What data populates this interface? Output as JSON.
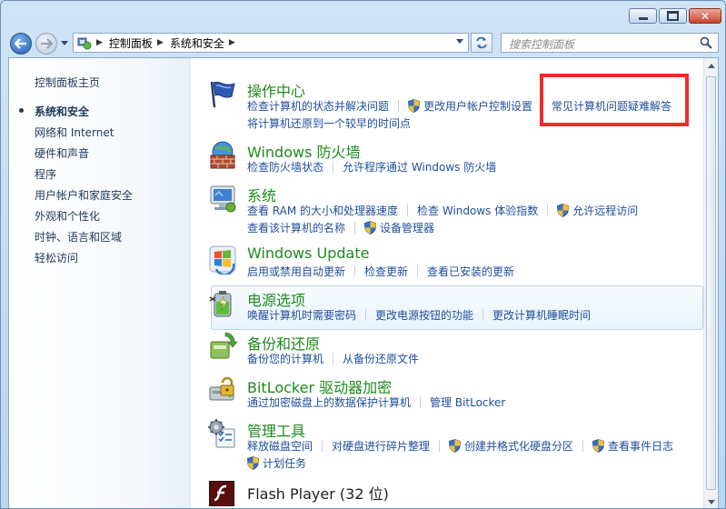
{
  "nav": {
    "breadcrumb": [
      "控制面板",
      "系统和安全"
    ],
    "search_placeholder": "搜索控制面板"
  },
  "sidebar": {
    "home": "控制面板主页",
    "items": [
      {
        "label": "系统和安全",
        "active": true
      },
      {
        "label": "网络和 Internet"
      },
      {
        "label": "硬件和声音"
      },
      {
        "label": "程序"
      },
      {
        "label": "用户帐户和家庭安全"
      },
      {
        "label": "外观和个性化"
      },
      {
        "label": "时钟、语言和区域"
      },
      {
        "label": "轻松访问"
      }
    ]
  },
  "categories": {
    "action_center": {
      "title": "操作中心",
      "links": [
        "检查计算机的状态并解决问题",
        "更改用户帐户控制设置",
        "常见计算机问题疑难解答",
        "将计算机还原到一个较早的时间点"
      ]
    },
    "firewall": {
      "title": "Windows 防火墙",
      "links": [
        "检查防火墙状态",
        "允许程序通过 Windows 防火墙"
      ]
    },
    "system": {
      "title": "系统",
      "links": [
        "查看 RAM 的大小和处理器速度",
        "检查 Windows 体验指数",
        "允许远程访问",
        "查看该计算机的名称",
        "设备管理器"
      ]
    },
    "windows_update": {
      "title": "Windows Update",
      "links": [
        "启用或禁用自动更新",
        "检查更新",
        "查看已安装的更新"
      ]
    },
    "power": {
      "title": "电源选项",
      "links": [
        "唤醒计算机时需要密码",
        "更改电源按钮的功能",
        "更改计算机睡眠时间"
      ]
    },
    "backup": {
      "title": "备份和还原",
      "links": [
        "备份您的计算机",
        "从备份还原文件"
      ]
    },
    "bitlocker": {
      "title": "BitLocker 驱动器加密",
      "links": [
        "通过加密磁盘上的数据保护计算机",
        "管理 BitLocker"
      ]
    },
    "admin_tools": {
      "title": "管理工具",
      "links": [
        "释放磁盘空间",
        "对硬盘进行碎片整理",
        "创建并格式化硬盘分区",
        "查看事件日志",
        "计划任务"
      ]
    },
    "flash": {
      "title": "Flash Player (32 位)"
    }
  },
  "colors": {
    "link": "#1f4e9c",
    "category_title": "#1d8b1d",
    "annotation": "#ee2b2b"
  }
}
